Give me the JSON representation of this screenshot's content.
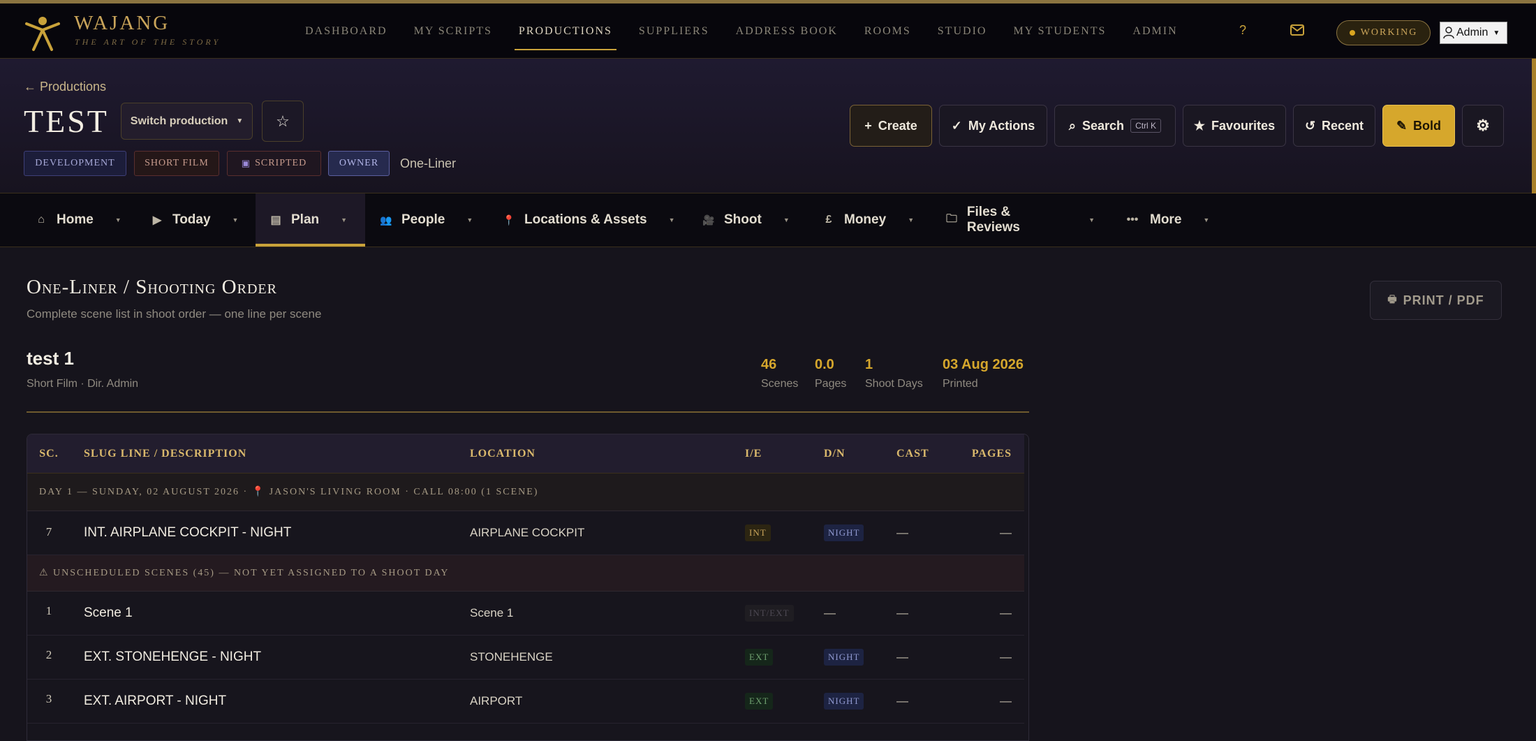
{
  "app": {
    "brand": "WAJANG",
    "tagline": "THE ART OF THE STORY",
    "nav": [
      "DASHBOARD",
      "MY SCRIPTS",
      "PRODUCTIONS",
      "SUPPLIERS",
      "ADDRESS BOOK",
      "ROOMS",
      "STUDIO",
      "MY STUDENTS",
      "ADMIN"
    ],
    "active_nav": "PRODUCTIONS",
    "help": "?",
    "status": "WORKING",
    "user": "Admin"
  },
  "production": {
    "back": "← Productions",
    "title": "TEST 1",
    "switch_label": "Switch production",
    "tags": {
      "stage": "DEVELOPMENT",
      "format": "SHORT FILM",
      "scripted": "SCRIPTED",
      "role": "OWNER"
    },
    "current_view": "One-Liner",
    "actions": {
      "create": "Create",
      "my_actions": "My Actions",
      "search": "Search",
      "search_kbd": "Ctrl K",
      "favourites": "Favourites",
      "recent": "Recent",
      "bold": "Bold"
    }
  },
  "subnav": {
    "tabs": [
      {
        "label": "Home",
        "icon": "⌂"
      },
      {
        "label": "Today",
        "icon": "▶"
      },
      {
        "label": "Plan",
        "icon": "▤"
      },
      {
        "label": "People",
        "icon": "👥"
      },
      {
        "label": "Locations & Assets",
        "icon": "📍"
      },
      {
        "label": "Shoot",
        "icon": "🎥"
      },
      {
        "label": "Money",
        "icon": "£"
      },
      {
        "label": "Files & Reviews",
        "icon": "🗀"
      },
      {
        "label": "More",
        "icon": "•••"
      }
    ],
    "active": "Plan"
  },
  "page": {
    "title": "One-Liner / Shooting Order",
    "subtitle": "Complete scene list in shoot order — one line per scene",
    "print_label": "PRINT / PDF"
  },
  "doc": {
    "title": "test 1",
    "meta": "Short Film · Dir. Admin",
    "stats": [
      {
        "value": "46",
        "label": "Scenes"
      },
      {
        "value": "0.0",
        "label": "Pages"
      },
      {
        "value": "1",
        "label": "Shoot Days"
      },
      {
        "value": "03 Aug 2026",
        "label": "Printed"
      }
    ]
  },
  "table": {
    "columns": [
      "SC.",
      "SLUG LINE / DESCRIPTION",
      "LOCATION",
      "I/E",
      "D/N",
      "CAST",
      "PAGES"
    ],
    "group_day1": "DAY 1 — SUNDAY, 02 AUGUST 2026 · 📍 JASON'S LIVING ROOM · CALL 08:00  (1 SCENE)",
    "group_unscheduled": "⚠ UNSCHEDULED SCENES (45) — NOT YET ASSIGNED TO A SHOOT DAY",
    "rows": [
      {
        "sc": "7",
        "slug": "INT. AIRPLANE COCKPIT - NIGHT",
        "location": "AIRPLANE COCKPIT",
        "ie": "INT",
        "dn": "NIGHT",
        "cast": "—",
        "pages": "—"
      },
      {
        "sc": "1",
        "slug": "Scene 1",
        "location": "Scene 1",
        "ie": "INT/EXT",
        "dn": "—",
        "cast": "—",
        "pages": "—"
      },
      {
        "sc": "2",
        "slug": "EXT. STONEHENGE - NIGHT",
        "location": "STONEHENGE",
        "ie": "EXT",
        "dn": "NIGHT",
        "cast": "—",
        "pages": "—"
      },
      {
        "sc": "3",
        "slug": "EXT. AIRPORT - NIGHT",
        "location": "AIRPORT",
        "ie": "EXT",
        "dn": "NIGHT",
        "cast": "—",
        "pages": "—"
      }
    ]
  }
}
